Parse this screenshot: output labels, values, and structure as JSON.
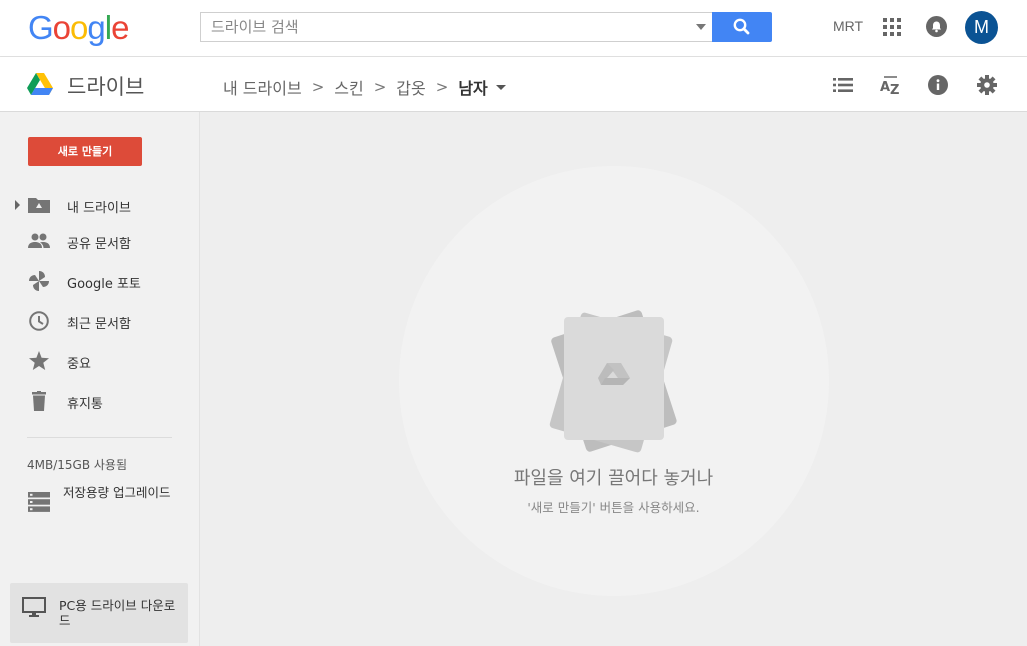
{
  "header": {
    "logo_letters": [
      {
        "ch": "G",
        "color": "#4285F4"
      },
      {
        "ch": "o",
        "color": "#EA4335"
      },
      {
        "ch": "o",
        "color": "#FBBC05"
      },
      {
        "ch": "g",
        "color": "#4285F4"
      },
      {
        "ch": "l",
        "color": "#34A853"
      },
      {
        "ch": "e",
        "color": "#EA4335"
      }
    ],
    "search_placeholder": "드라이브 검색",
    "search_icon": "search-icon",
    "user_label": "MRT",
    "apps_icon": "apps-grid-icon",
    "notifications_icon": "bell-icon",
    "avatar_initial": "M",
    "accent_color": "#4285F4"
  },
  "subheader": {
    "app_title": "드라이브",
    "breadcrumb": [
      "내 드라이브",
      "스킨",
      "갑옷"
    ],
    "breadcrumb_current": "남자",
    "breadcrumb_separator": ">",
    "tools": [
      "list-view-icon",
      "sort-az-icon",
      "info-icon",
      "settings-icon"
    ]
  },
  "sidebar": {
    "new_button": "새로 만들기",
    "new_button_color": "#DD4B39",
    "items": [
      {
        "label": "내 드라이브",
        "icon": "my-drive-folder-icon"
      },
      {
        "label": "공유 문서함",
        "icon": "shared-people-icon"
      },
      {
        "label": "Google 포토",
        "icon": "photos-pinwheel-icon"
      },
      {
        "label": "최근 문서함",
        "icon": "clock-icon"
      },
      {
        "label": "중요",
        "icon": "star-icon"
      },
      {
        "label": "휴지통",
        "icon": "trash-icon"
      }
    ],
    "storage_text": "4MB/15GB 사용됨",
    "upgrade_label": "저장용량 업그레이드",
    "pc_download_label": "PC용 드라이브 다운로드"
  },
  "main": {
    "empty_title": "파일을 여기 끌어다 놓거나",
    "empty_subtitle": "'새로 만들기' 버튼을 사용하세요."
  }
}
